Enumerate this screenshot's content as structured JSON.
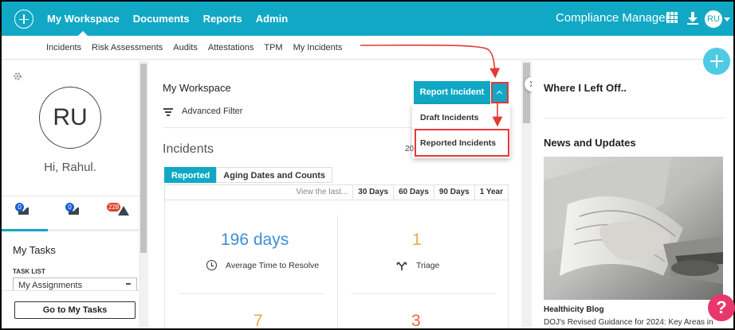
{
  "topbar": {
    "nav": [
      "My Workspace",
      "Documents",
      "Reports",
      "Admin"
    ],
    "brand": "Compliance Manager",
    "user_initials": "RU"
  },
  "subnav": [
    "Incidents",
    "Risk Assessments",
    "Audits",
    "Attestations",
    "TPM",
    "My Incidents"
  ],
  "profile": {
    "initials": "RU",
    "greeting": "Hi, Rahul."
  },
  "notifications": {
    "messages_count": "0",
    "alerts_count": "0",
    "warnings_count": "228"
  },
  "tasks": {
    "title": "My Tasks",
    "list_label": "TASK LIST",
    "selected": "My Assignments",
    "go_button": "Go to My Tasks"
  },
  "main": {
    "title": "My Workspace",
    "advanced_filter": "Advanced Filter",
    "report_button": "Report Incident",
    "dropdown": [
      "Draft Incidents",
      "Reported Incidents"
    ],
    "incidents_title": "Incidents",
    "partial_date": "20",
    "tabs": [
      "Reported",
      "Aging Dates and Counts"
    ],
    "range": {
      "view_label": "View the last...",
      "options": [
        "30 Days",
        "60 Days",
        "90 Days",
        "1 Year"
      ]
    },
    "stats": [
      {
        "value": "196 days",
        "label": "Average Time to Resolve",
        "color": "#3a8fd8"
      },
      {
        "value": "1",
        "label": "Triage",
        "color": "#f0a54a"
      },
      {
        "value": "7",
        "color": "#f0a54a"
      },
      {
        "value": "3",
        "color": "#e8663a"
      }
    ]
  },
  "right": {
    "where_title": "Where I Left Off..",
    "news_title": "News and Updates",
    "blog_source": "Healthicity Blog",
    "blog_headline": "DOJ's Revised Guidance for 2024: Key Areas in"
  },
  "colors": {
    "brand": "#11a8c5",
    "annotation": "#e53935",
    "help": "#e8386b"
  },
  "icons": [
    "logo-icon",
    "gear-icon",
    "grid-icon",
    "download-icon",
    "envelope-icon",
    "warning-icon",
    "filter-icon",
    "clock-icon",
    "triage-icon",
    "help-icon",
    "add-icon"
  ]
}
